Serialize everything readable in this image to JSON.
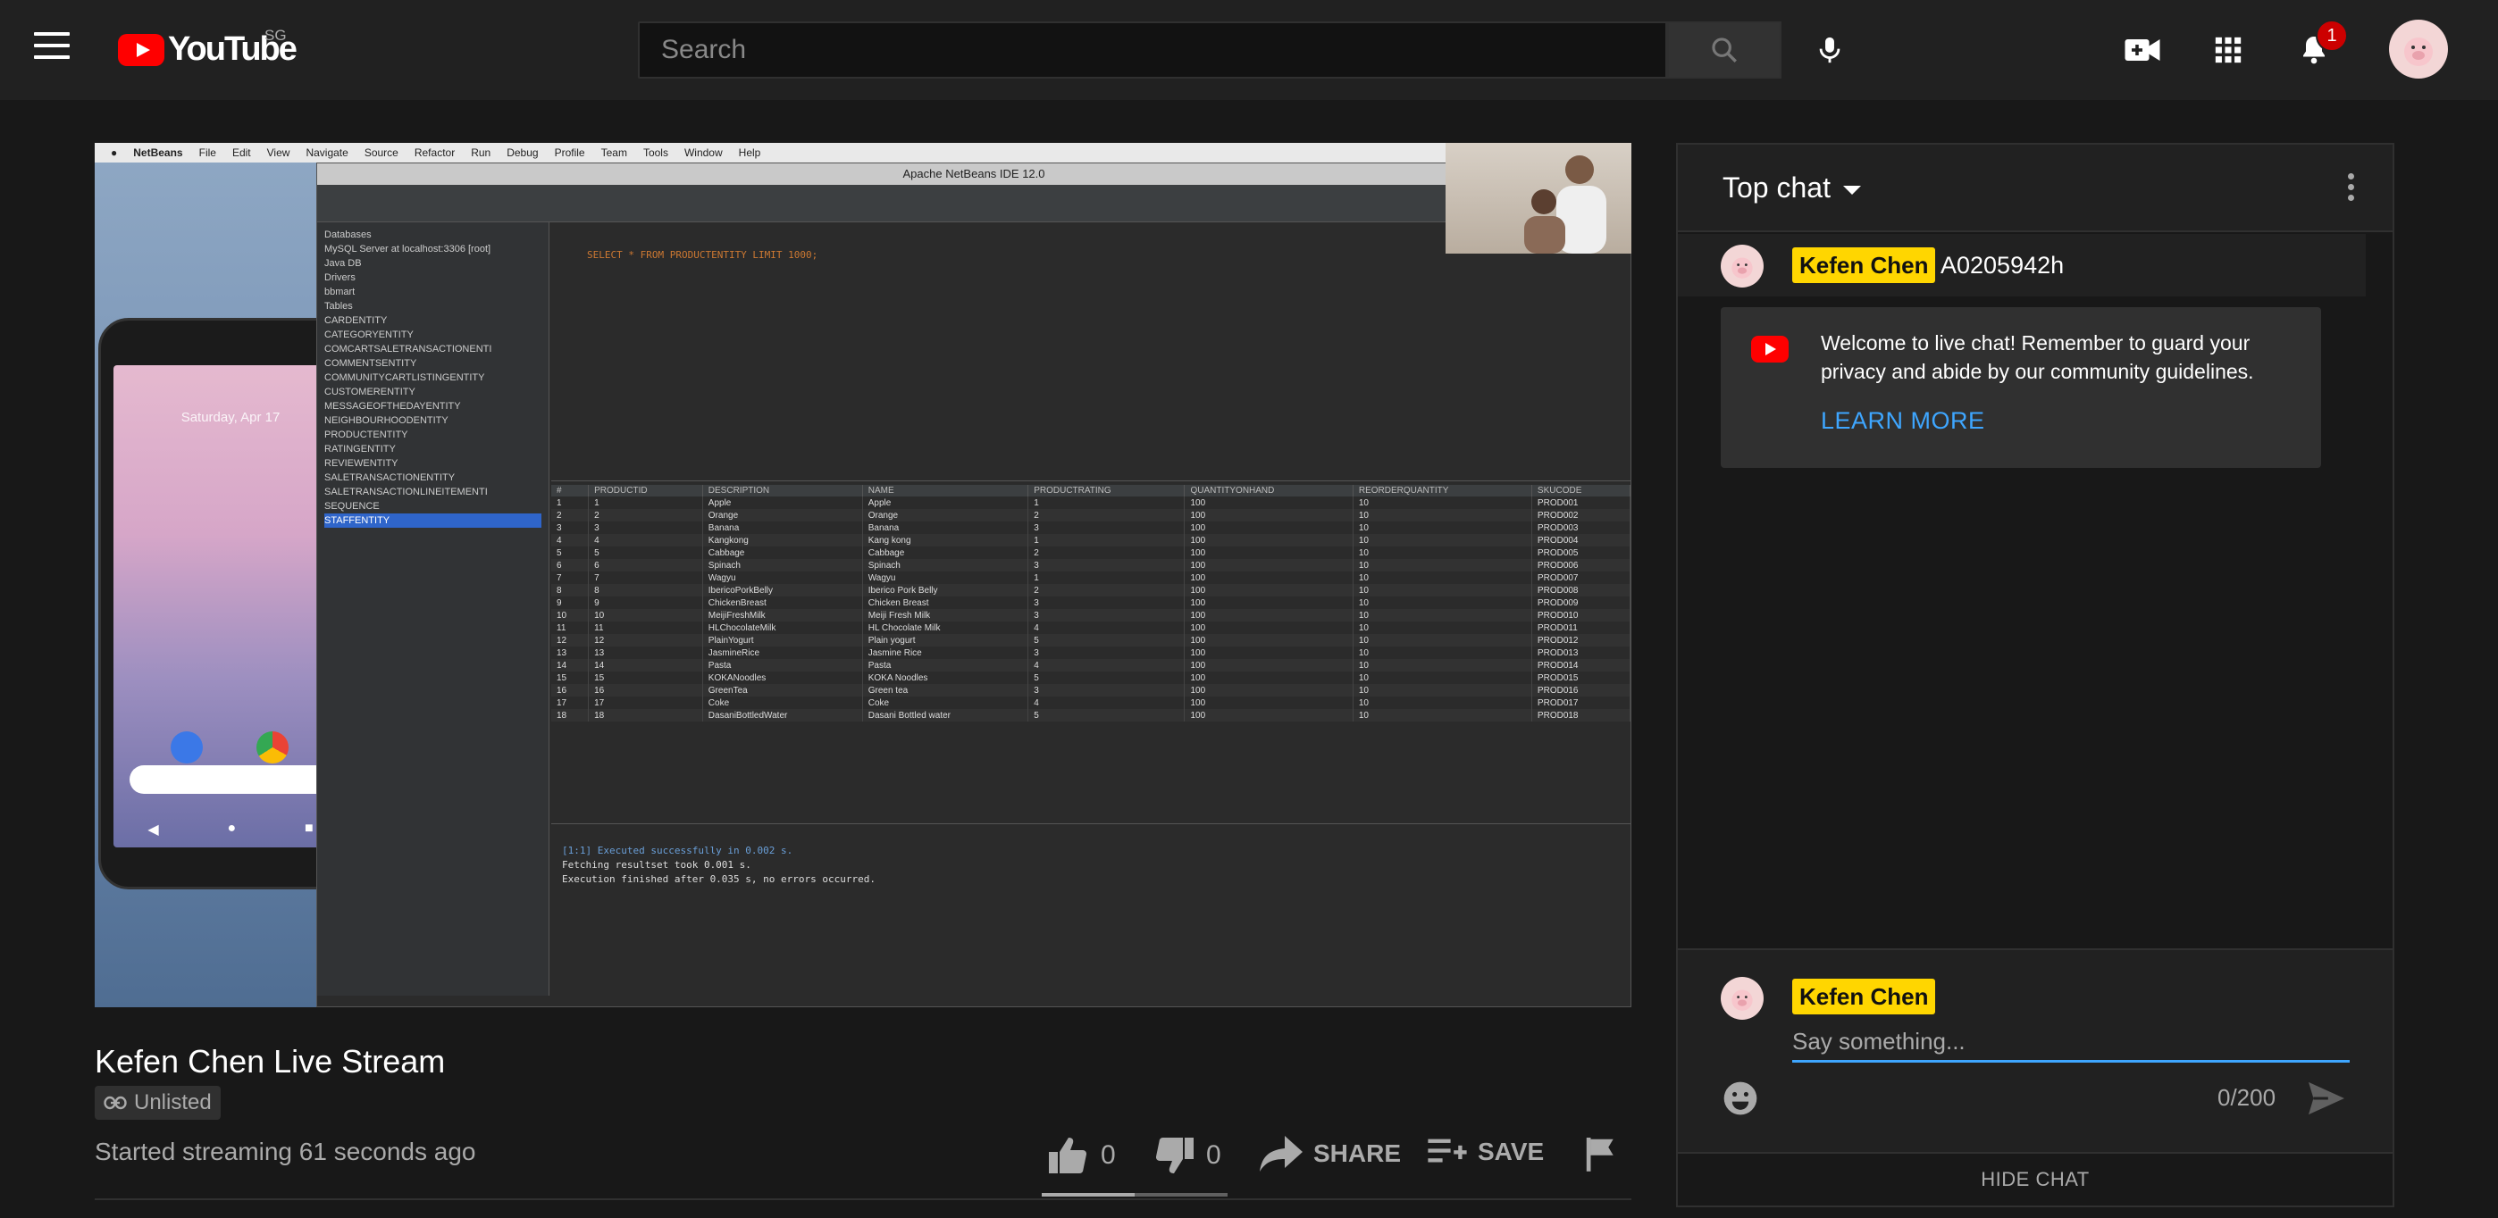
{
  "header": {
    "logo_text": "YouTube",
    "region": "SG",
    "search_placeholder": "Search",
    "notification_count": "1"
  },
  "video": {
    "title": "Kefen Chen Live Stream",
    "visibility": "Unlisted",
    "status": "Started streaming 61 seconds ago",
    "like_count": "0",
    "dislike_count": "0",
    "share_label": "SHARE",
    "save_label": "SAVE",
    "like_ratio": 0.5,
    "screen": {
      "mac_menu": [
        "NetBeans",
        "File",
        "Edit",
        "View",
        "Navigate",
        "Source",
        "Refactor",
        "Run",
        "Debug",
        "Profile",
        "Team",
        "Tools",
        "Window",
        "Help"
      ],
      "ide_title": "Apache NetBeans IDE 12.0",
      "phone_date": "Saturday, Apr 17",
      "sql_query": "SELECT * FROM PRODUCTENTITY LIMIT 1000;",
      "db_tree": [
        "Databases",
        "MySQL Server at localhost:3306 [root]",
        "Java DB",
        "Drivers",
        "bbmart",
        "Tables",
        "CARDENTITY",
        "CATEGORYENTITY",
        "COMCARTSALETRANSACTIONENTI",
        "COMMENTSENTITY",
        "COMMUNITYCARTLISTINGENTITY",
        "CUSTOMERENTITY",
        "MESSAGEOFTHEDAYENTITY",
        "NEIGHBOURHOODENTITY",
        "PRODUCTENTITY",
        "RATINGENTITY",
        "REVIEWENTITY",
        "SALETRANSACTIONENTITY",
        "SALETRANSACTIONLINEITEMENTI",
        "SEQUENCE",
        "STAFFENTITY"
      ],
      "columns": [
        "#",
        "PRODUCTID",
        "DESCRIPTION",
        "NAME",
        "PRODUCTRATING",
        "QUANTITYONHAND",
        "REORDERQUANTITY",
        "SKUCODE"
      ],
      "rows": [
        [
          "1",
          "1",
          "Apple",
          "Apple",
          "1",
          "100",
          "10",
          "PROD001"
        ],
        [
          "2",
          "2",
          "Orange",
          "Orange",
          "2",
          "100",
          "10",
          "PROD002"
        ],
        [
          "3",
          "3",
          "Banana",
          "Banana",
          "3",
          "100",
          "10",
          "PROD003"
        ],
        [
          "4",
          "4",
          "Kangkong",
          "Kang kong",
          "1",
          "100",
          "10",
          "PROD004"
        ],
        [
          "5",
          "5",
          "Cabbage",
          "Cabbage",
          "2",
          "100",
          "10",
          "PROD005"
        ],
        [
          "6",
          "6",
          "Spinach",
          "Spinach",
          "3",
          "100",
          "10",
          "PROD006"
        ],
        [
          "7",
          "7",
          "Wagyu",
          "Wagyu",
          "1",
          "100",
          "10",
          "PROD007"
        ],
        [
          "8",
          "8",
          "IbericoPorkBelly",
          "Iberico Pork Belly",
          "2",
          "100",
          "10",
          "PROD008"
        ],
        [
          "9",
          "9",
          "ChickenBreast",
          "Chicken Breast",
          "3",
          "100",
          "10",
          "PROD009"
        ],
        [
          "10",
          "10",
          "MeijiFreshMilk",
          "Meiji Fresh Milk",
          "3",
          "100",
          "10",
          "PROD010"
        ],
        [
          "11",
          "11",
          "HLChocolateMilk",
          "HL Chocolate Milk",
          "4",
          "100",
          "10",
          "PROD011"
        ],
        [
          "12",
          "12",
          "PlainYogurt",
          "Plain yogurt",
          "5",
          "100",
          "10",
          "PROD012"
        ],
        [
          "13",
          "13",
          "JasmineRice",
          "Jasmine Rice",
          "3",
          "100",
          "10",
          "PROD013"
        ],
        [
          "14",
          "14",
          "Pasta",
          "Pasta",
          "4",
          "100",
          "10",
          "PROD014"
        ],
        [
          "15",
          "15",
          "KOKANoodles",
          "KOKA Noodles",
          "5",
          "100",
          "10",
          "PROD015"
        ],
        [
          "16",
          "16",
          "GreenTea",
          "Green tea",
          "3",
          "100",
          "10",
          "PROD016"
        ],
        [
          "17",
          "17",
          "Coke",
          "Coke",
          "4",
          "100",
          "10",
          "PROD017"
        ],
        [
          "18",
          "18",
          "DasaniBottledWater",
          "Dasani Bottled water",
          "5",
          "100",
          "10",
          "PROD018"
        ]
      ],
      "output_lines": [
        "[1:1] Executed successfully in 0.002 s.",
        "Fetching resultset took 0.001 s.",
        "",
        "Execution finished after 0.035 s, no errors occurred."
      ]
    }
  },
  "chat": {
    "mode_label": "Top chat",
    "pinned_author": "Kefen Chen",
    "pinned_message": "A0205942h",
    "welcome_text": "Welcome to live chat! Remember to guard your privacy and abide by our community guidelines.",
    "learn_more": "LEARN MORE",
    "input_author": "Kefen Chen",
    "input_placeholder": "Say something...",
    "char_counter": "0/200",
    "hide_chat_label": "HIDE CHAT"
  }
}
